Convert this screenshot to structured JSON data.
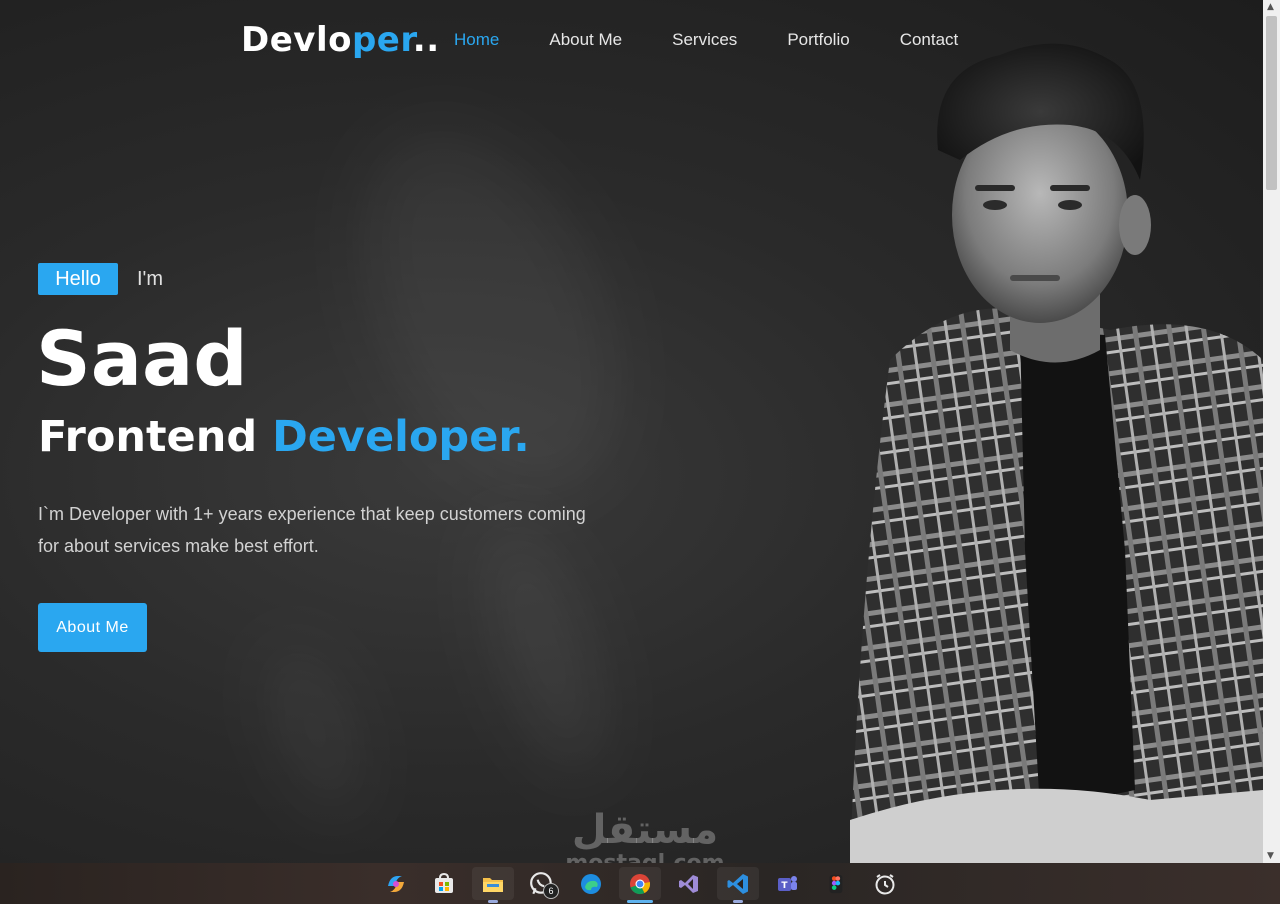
{
  "nav": {
    "logo_main": "Devlo",
    "logo_accent": "per",
    "logo_suffix": "..",
    "links": [
      {
        "label": "Home",
        "active": true
      },
      {
        "label": "About Me",
        "active": false
      },
      {
        "label": "Services",
        "active": false
      },
      {
        "label": "Portfolio",
        "active": false
      },
      {
        "label": "Contact",
        "active": false
      }
    ]
  },
  "hero": {
    "hello": "Hello",
    "im": "I'm",
    "name": "Saad",
    "role_main": "Frontend ",
    "role_accent": "Developer.",
    "description": "I`m Developer with 1+ years experience that keep customers coming for about services make best effort.",
    "cta_label": "About Me"
  },
  "watermark": {
    "arabic": "مستقل",
    "latin": "mostaql.com"
  },
  "taskbar": {
    "apps": [
      {
        "name": "copilot-icon"
      },
      {
        "name": "microsoft-store-icon"
      },
      {
        "name": "file-explorer-icon"
      },
      {
        "name": "whatsapp-icon",
        "badge": "6"
      },
      {
        "name": "edge-icon"
      },
      {
        "name": "chrome-icon"
      },
      {
        "name": "visual-studio-icon"
      },
      {
        "name": "vscode-icon"
      },
      {
        "name": "teams-icon"
      },
      {
        "name": "figma-icon"
      },
      {
        "name": "clock-icon"
      }
    ]
  },
  "colors": {
    "accent": "#2aa7f0",
    "background": "#2a2a2a",
    "text": "#ffffff"
  }
}
